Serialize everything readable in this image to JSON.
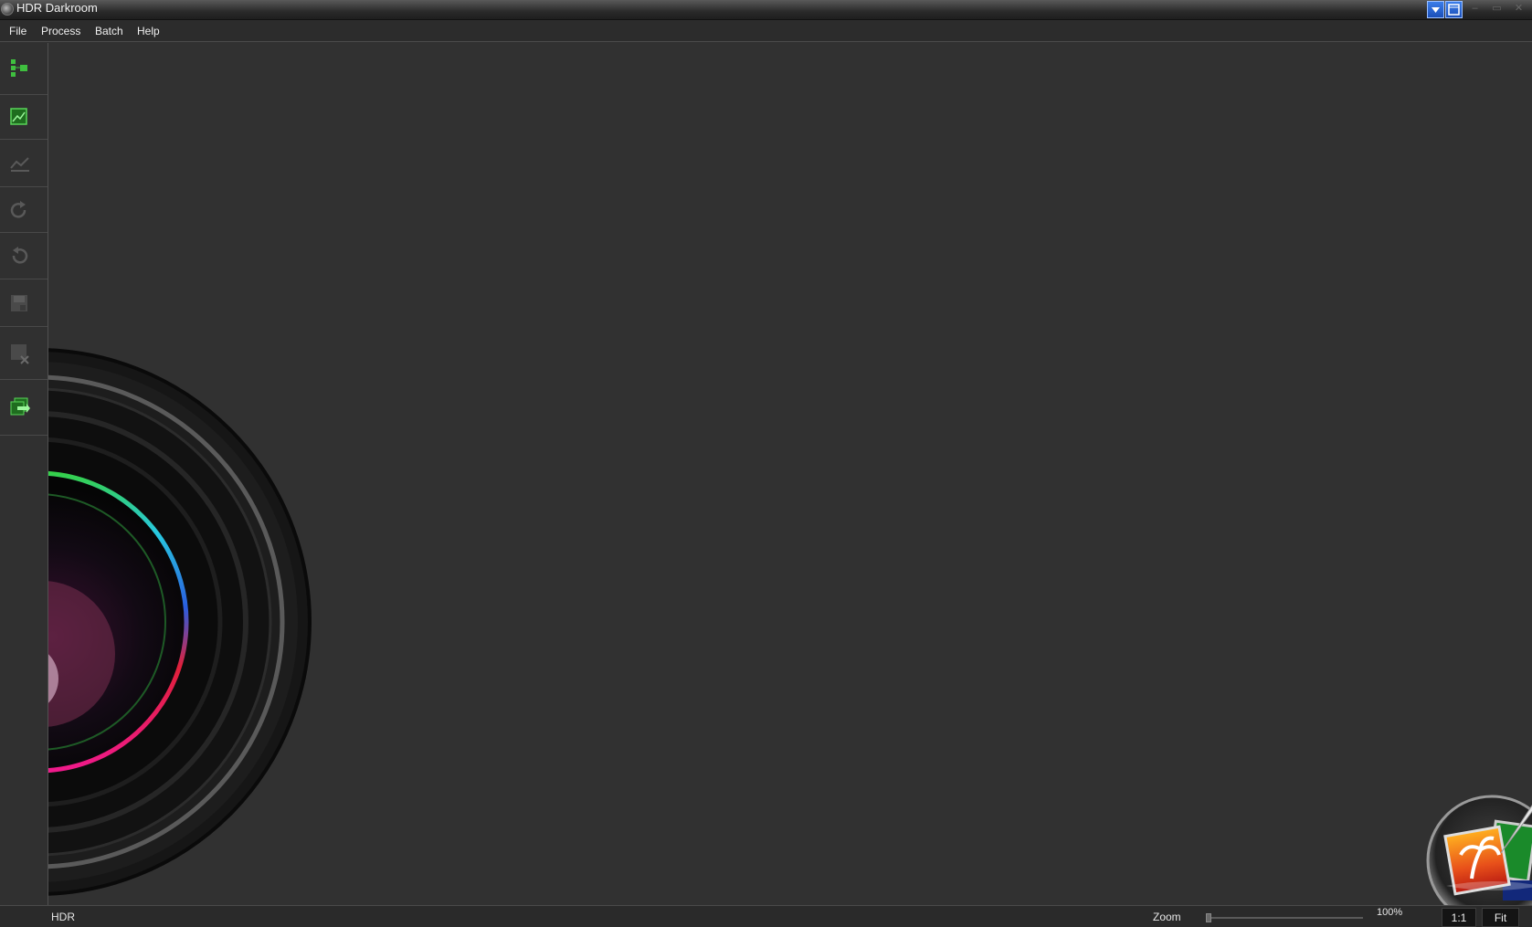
{
  "window": {
    "title": "HDR Darkroom",
    "controls": [
      "dropdown-icon",
      "window-layout-icon",
      "minimize-icon",
      "maximize-icon",
      "close-icon"
    ]
  },
  "menu": {
    "items": [
      {
        "label": "File"
      },
      {
        "label": "Process"
      },
      {
        "label": "Batch"
      },
      {
        "label": "Help"
      }
    ]
  },
  "toolbar": {
    "tools": [
      {
        "icon": "hierarchy-icon",
        "enabled": true
      },
      {
        "icon": "open-image-icon",
        "enabled": true
      },
      {
        "icon": "curve-icon",
        "enabled": false
      },
      {
        "icon": "redo-icon",
        "enabled": false
      },
      {
        "icon": "undo-icon",
        "enabled": false
      },
      {
        "icon": "save-icon",
        "enabled": false
      },
      {
        "icon": "close-image-icon",
        "enabled": false
      },
      {
        "icon": "batch-export-icon",
        "enabled": true
      }
    ]
  },
  "colors": {
    "background": "#313131",
    "accent_green": "#3fbf3f",
    "titlebar_blue": "#2b63d6"
  },
  "status": {
    "mode": "HDR",
    "zoom_label": "Zoom",
    "zoom_value": "100%",
    "zoom_level": 0.0,
    "one_to_one_label": "1:1",
    "fit_label": "Fit"
  }
}
